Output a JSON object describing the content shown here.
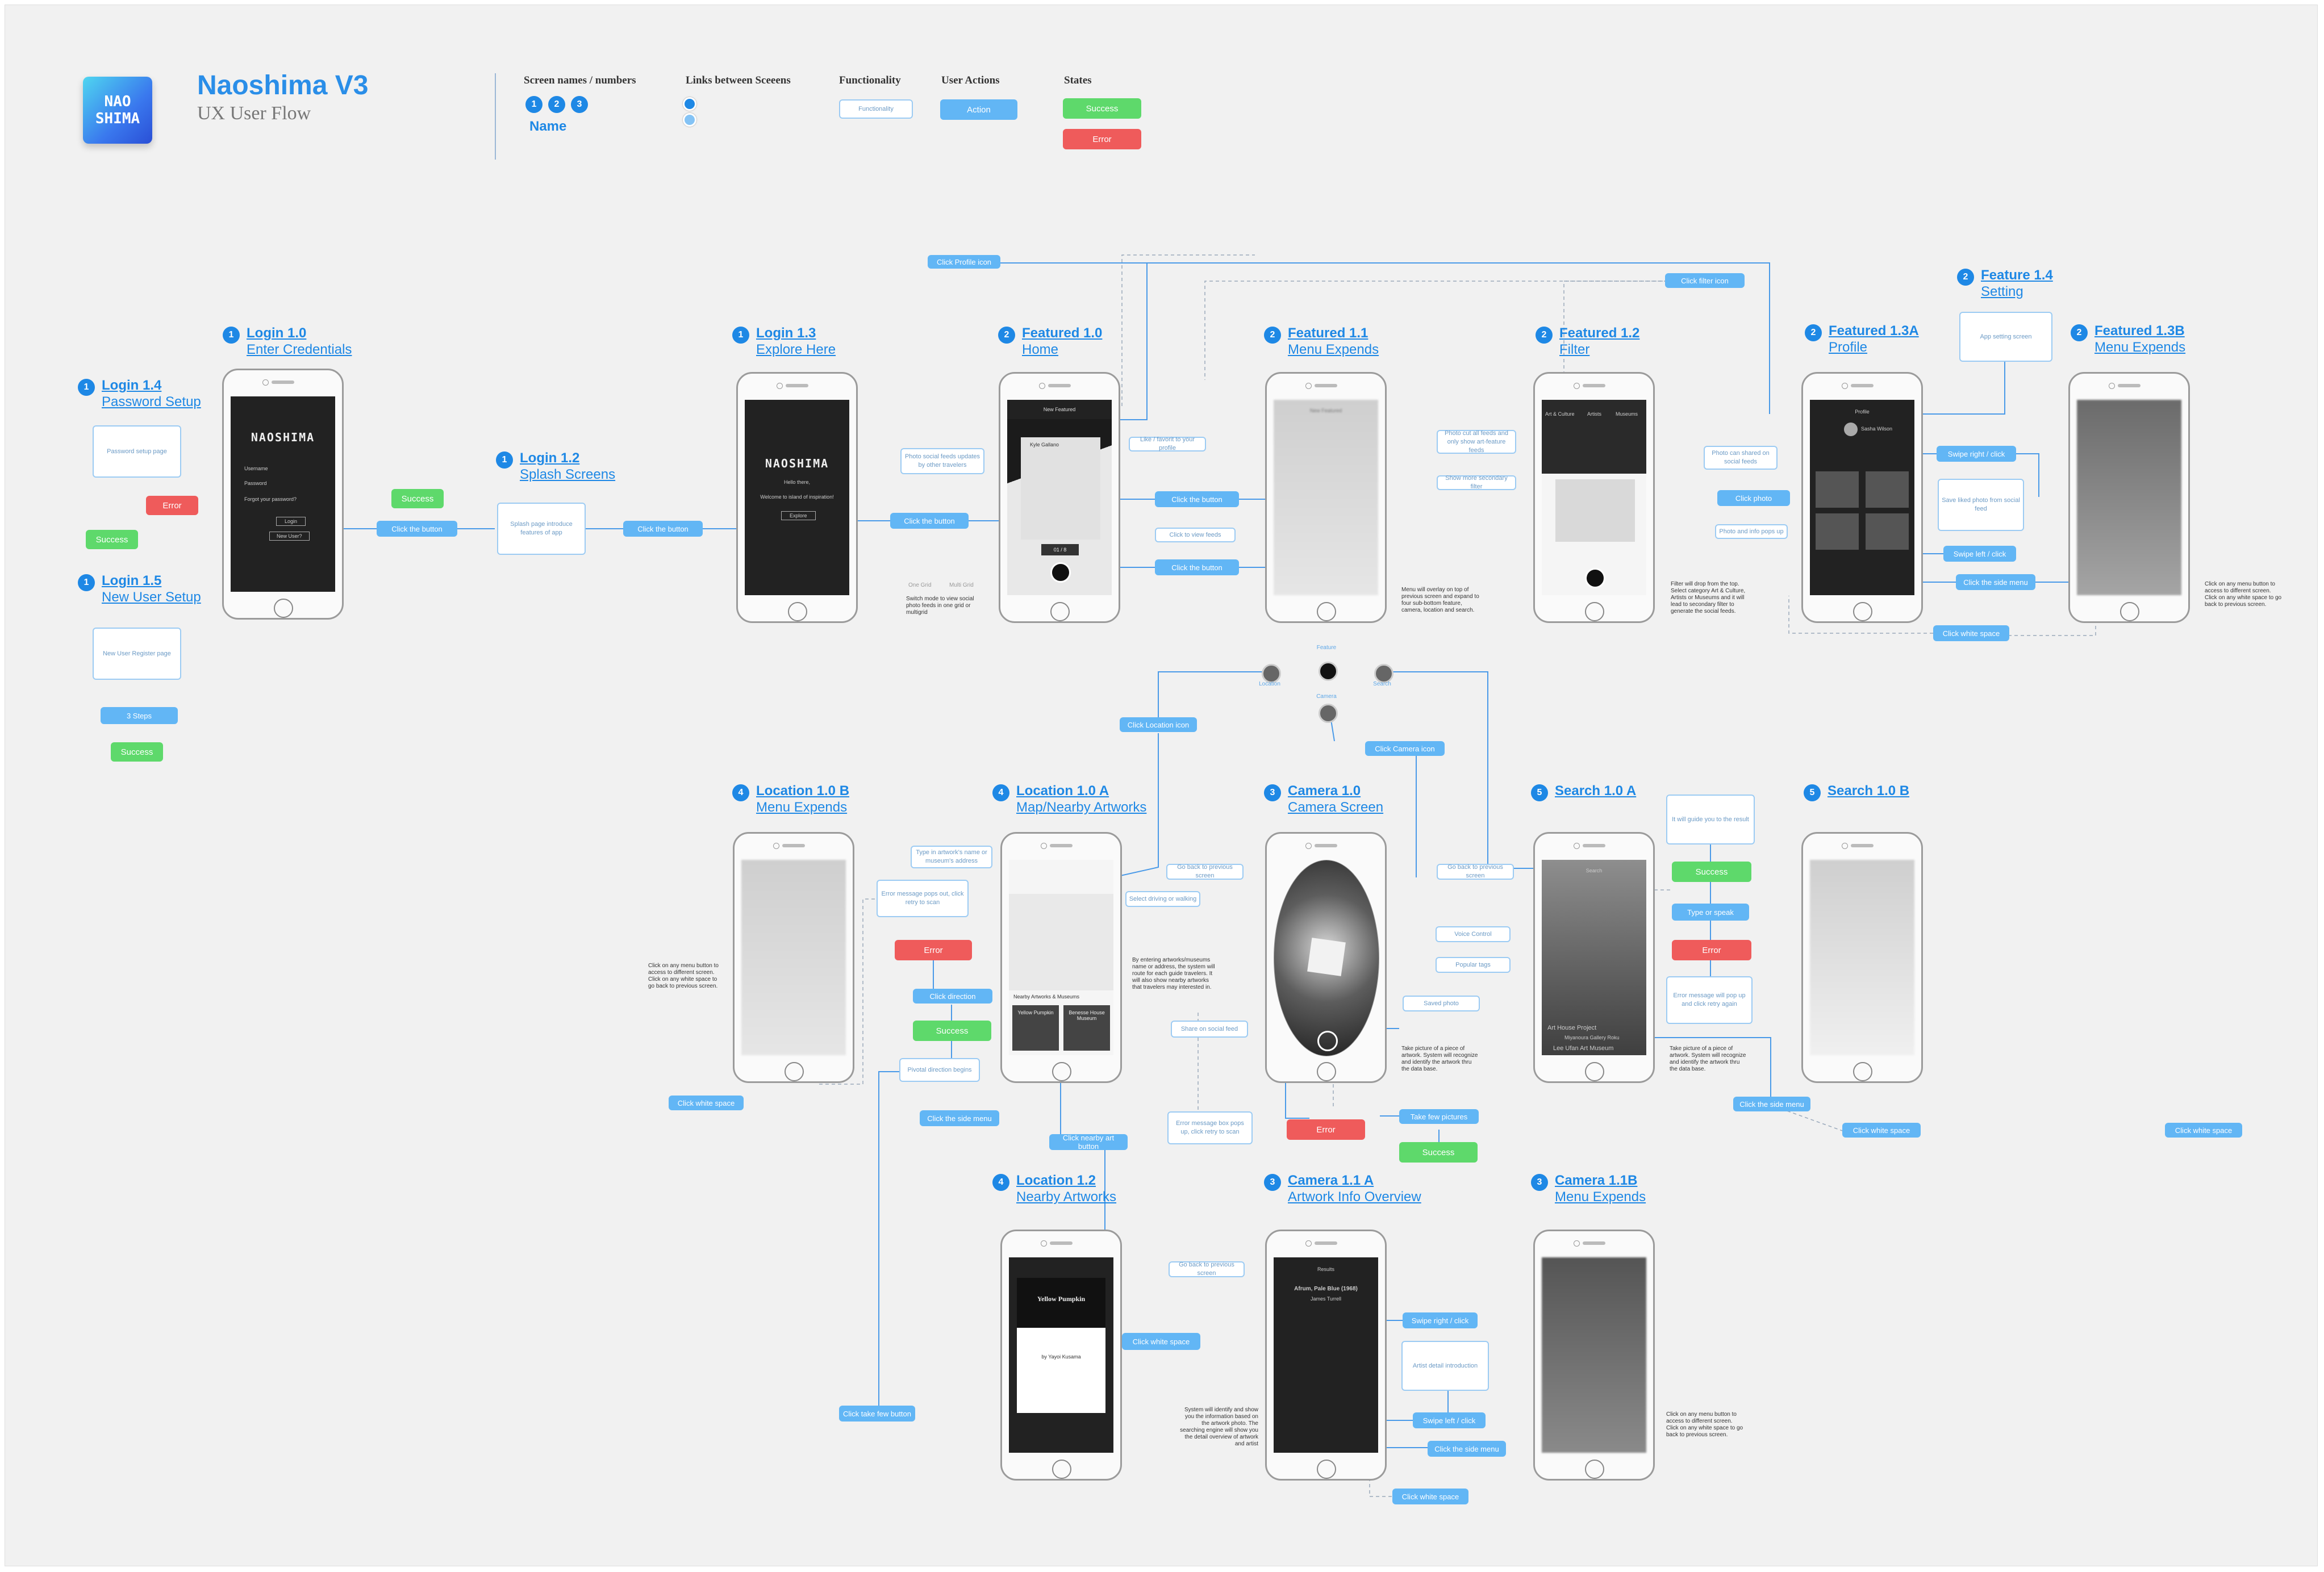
{
  "header": {
    "logo_text": "NAO\nSHIMA",
    "title": "Naoshima V3",
    "subtitle": "UX User Flow"
  },
  "legend": {
    "screen_names_label": "Screen names / numbers",
    "numbers": [
      "1",
      "2",
      "3"
    ],
    "name_label": "Name",
    "links_label": "Links between Sceeens",
    "functionality_label": "Functionality",
    "functionality_sample": "Functionality",
    "user_actions_label": "User Actions",
    "action_sample": "Action",
    "states_label": "States",
    "success_sample": "Success",
    "error_sample": "Error"
  },
  "colors": {
    "accent": "#1e88e5",
    "action": "#62b6f5",
    "success": "#5ed96b",
    "error": "#ef5b5b",
    "board": "#f1f1f1"
  },
  "screens": {
    "login_1_0": {
      "num": "1",
      "title": "Login 1.0",
      "subtitle": "Enter Credentials",
      "brand": "NAOSHIMA",
      "fields": [
        "Username",
        "Password",
        "Forgot your password?",
        "Login",
        "New User?"
      ]
    },
    "login_1_3": {
      "num": "1",
      "title": "Login 1.3",
      "subtitle": "Explore Here",
      "brand": "NAOSHIMA",
      "line1": "Hello there,",
      "line2": "Welcome to island of inspiration!",
      "cta": "Explore"
    },
    "login_1_4": {
      "num": "1",
      "title": "Login 1.4",
      "subtitle": "Password Setup"
    },
    "login_1_5": {
      "num": "1",
      "title": "Login 1.5",
      "subtitle": "New User Setup"
    },
    "login_1_2": {
      "num": "1",
      "title": "Login 1.2",
      "subtitle": "Splash Screens"
    },
    "featured_1_0": {
      "num": "2",
      "title": "Featured  1.0",
      "subtitle": "Home",
      "header": "New Featured",
      "user": "Kyle Gallano",
      "tag": "01 / 8"
    },
    "featured_1_1": {
      "num": "2",
      "title": "Featured  1.1",
      "subtitle": "Menu Expends",
      "header": "New Featured"
    },
    "featured_1_2": {
      "num": "2",
      "title": "Featured  1.2",
      "subtitle": "Filter",
      "tabs": [
        "Art & Culture",
        "Artists",
        "Museums"
      ]
    },
    "featured_1_3a": {
      "num": "2",
      "title": "Featured  1.3A",
      "subtitle": "Profile",
      "header": "Profile",
      "user": "Sasha Wilson"
    },
    "featured_1_3b": {
      "num": "2",
      "title": "Featured  1.3B",
      "subtitle": "Menu Expends"
    },
    "feature_1_4": {
      "num": "2",
      "title": "Feature 1.4",
      "subtitle": "Setting"
    },
    "location_1_0b": {
      "num": "4",
      "title": "Location 1.0 B",
      "subtitle": "Menu Expends"
    },
    "location_1_0a": {
      "num": "4",
      "title": "Location 1.0 A",
      "subtitle": "Map/Nearby Artworks",
      "section": "Nearby Artworks & Museums",
      "cards": [
        "Yellow Pumpkin",
        "Benesse House Museum"
      ]
    },
    "camera_1_0": {
      "num": "3",
      "title": "Camera 1.0",
      "subtitle": "Camera Screen"
    },
    "search_1_0a": {
      "num": "5",
      "title": "Search 1.0 A",
      "subtitle": "",
      "header": "Search",
      "items": [
        "Art House Project",
        "Miyanoura Gallery Roku",
        "Lee Ufan Art Museum"
      ]
    },
    "search_1_0b": {
      "num": "5",
      "title": "Search 1.0 B",
      "subtitle": ""
    },
    "location_1_2": {
      "num": "4",
      "title": "Location 1.2",
      "subtitle": "Nearby Artworks",
      "art_title": "Yellow Pumpkin",
      "art_sub": "by Yayoi Kusama"
    },
    "camera_1_1a": {
      "num": "3",
      "title": "Camera 1.1 A",
      "subtitle": "Artwork Info Overview",
      "header": "Results",
      "art_title": "Afrum, Pale Blue (1968)",
      "artist": "James Turrell"
    },
    "camera_1_1b": {
      "num": "3",
      "title": "Camera 1.1B",
      "subtitle": "Menu Expends"
    }
  },
  "nav_icons": {
    "location": "Location",
    "feature": "Feature",
    "search": "Search",
    "camera": "Camera"
  },
  "flow": {
    "actions": [
      "Click the button",
      "Click the button",
      "Click the button",
      "Click the button",
      "Click the button",
      "Click Profile icon",
      "Click filter icon",
      "3 Steps",
      "Click white space",
      "Click white space",
      "Click photo",
      "Swipe right / click",
      "Swipe left / click",
      "Click the side menu",
      "Click white space",
      "Click Location icon",
      "Click Camera icon",
      "Click white space",
      "Click direction",
      "Click  the side menu",
      "Click nearby art  button",
      "Take few pictures",
      "Type or speak",
      "Click  the side menu",
      "Click white space",
      "Click white space",
      "Swipe right / click",
      "Swipe left / click",
      "Click  the side menu",
      "Click white space",
      "Click  take few button"
    ],
    "functions": [
      "Password setup page",
      "New User Register page",
      "Splash page introduce features of app",
      "Photo social feeds updates by other travelers",
      "Like / favorit to your profile",
      "Click to view feeds",
      "Photo cut all feeds and only show art-feature feeds",
      "Show more secondary filter",
      "Photo can shared on social feeds",
      "Photo and info pops up",
      "App setting screen",
      "Save liked photo from social feed",
      "Type in artwork's name or museum's address",
      "Error message pops out, click retry to scan",
      "Pivotal direction begins",
      "Go back to previous screen",
      "Select driving or walking",
      "Error message box pops up, click retry to scan",
      "Go back to previous screen",
      "Voice Control",
      "Popular tags",
      "Saved photo",
      "Share on social feed",
      "It will guide you to the result",
      "Error message will pop up and click retry again",
      "Go back to previous screen",
      "Artist detail introduction"
    ],
    "states": [
      "Success",
      "Success",
      "Success",
      "Error",
      "Error",
      "Success",
      "Error",
      "Success",
      "Success",
      "Error",
      "Success",
      "Error",
      "Success"
    ]
  },
  "notes": {
    "switch_mode": "Switch mode to view social photo feeds in one grid or multigrid",
    "menu_overlay": "Menu will overlay on top of previous screen and expand to four sub-bottom feature, camera, location and search.",
    "filter_note": "Filter will drop from the top. Select category Art & Culture, Artists or Museums and it will lead to secondary filter to generate the social feeds.",
    "menu_btn_1": "Click on any menu button to access to different screen. Click on any white space to go back to previous screen.",
    "menu_btn_2": "Click on any menu button to access to different screen. Click on any white space to go back to previous screen.",
    "menu_btn_3": "Click on any menu button to access to different screen. Click on any white space to go back to previous screen.",
    "location_note": "By entering artworks/museums name or address, the system will route for each guide travelers. It will also show nearby artworks that travelers may interested in.",
    "camera_note": "Take picture of a piece of artwork. System will recognize and identify the artwork thru the data base.",
    "search_note": "Take picture of a piece of artwork. System will recognize and identify the artwork thru the data base.",
    "camera_info_note": "System will identify and show you the information based on the artwork photo. The searching engine will show you the detail overview of artwork and artist",
    "one_grid": "One Grid",
    "multi_grid": "Multi Grid"
  }
}
